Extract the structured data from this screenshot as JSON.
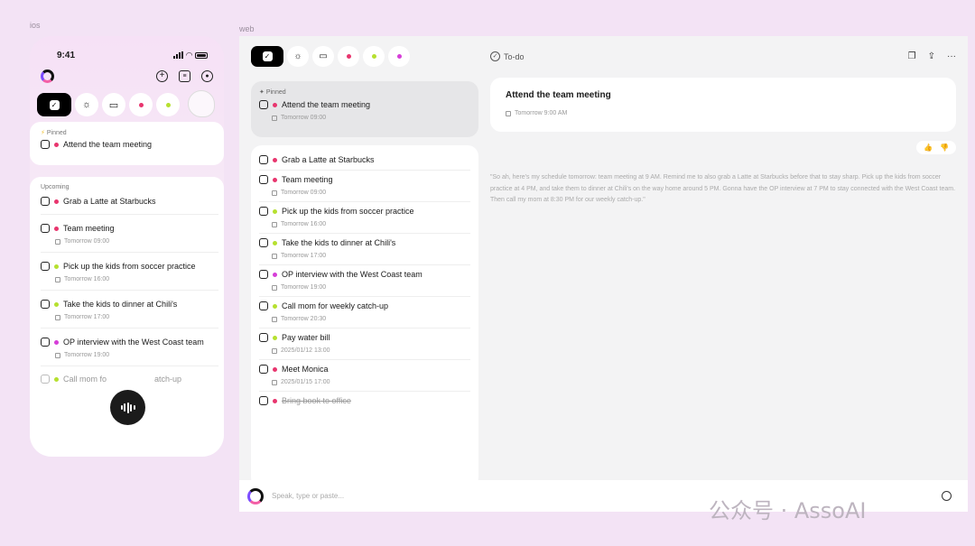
{
  "labels": {
    "ios": "ios",
    "web": "web"
  },
  "ios": {
    "time": "9:41",
    "pinned_title": "Pinned",
    "pinned_item": "Attend the team meeting",
    "upcoming_title": "Upcoming",
    "items": [
      {
        "title": "Grab a Latte at Starbucks",
        "meta": "",
        "dot": "#e8356e"
      },
      {
        "title": "Team meeting",
        "meta": "Tomorrow 09:00",
        "dot": "#e8356e"
      },
      {
        "title": "Pick up the kids from soccer practice",
        "meta": "Tomorrow 16:00",
        "dot": "#b6e02f"
      },
      {
        "title": "Take the kids to dinner at Chili's",
        "meta": "Tomorrow 17:00",
        "dot": "#b6e02f"
      },
      {
        "title": "OP interview with the West Coast team",
        "meta": "Tomorrow 19:00",
        "dot": "#d63ed8"
      }
    ],
    "last_left": "Call mom fo",
    "last_right": "atch-up"
  },
  "web": {
    "pinned_title": "Pinned",
    "pinned_item": "Attend the team meeting",
    "pinned_meta": "Tomorrow 09:00",
    "items": [
      {
        "title": "Grab a Latte  at Starbucks",
        "meta": "",
        "dot": "#e8356e"
      },
      {
        "title": "Team meeting",
        "meta": "Tomorrow 09:00",
        "dot": "#e8356e"
      },
      {
        "title": "Pick up the kids from soccer practice",
        "meta": "Tomorrow 16:00",
        "dot": "#b6e02f"
      },
      {
        "title": "Take the kids to dinner at Chili's",
        "meta": "Tomorrow 17:00",
        "dot": "#b6e02f"
      },
      {
        "title": "OP interview with the West Coast team",
        "meta": "Tomorrow 19:00",
        "dot": "#d63ed8"
      },
      {
        "title": " Call mom for weekly catch-up",
        "meta": "Tomorrow 20:30",
        "dot": "#b6e02f"
      },
      {
        "title": "Pay water bill",
        "meta": "2025/01/12 13:00",
        "dot": "#b6e02f"
      },
      {
        "title": "Meet Monica",
        "meta": "2025/01/15 17:00",
        "dot": "#e8356e"
      }
    ],
    "done_item": "Bring book to office",
    "header_label": "To-do",
    "detail_title": "Attend the team meeting",
    "detail_meta": "Tomorrow 9:00 AM",
    "transcript": "\"So ah, here's my schedule tomorrow: team meeting at 9 AM. Remind me to also grab a Latte at Starbucks before that to stay sharp. Pick up the kids from soccer practice at 4 PM, and take them to dinner at Chili's on the way home around 5 PM. Gonna have the OP interview at 7 PM to stay connected with the West Coast team. Then call my mom at 8:30 PM for our weekly catch-up.\"",
    "input_placeholder": "Speak, type or paste..."
  },
  "watermark": "公众号 · AssoAI",
  "colors": {
    "pink": "#e8356e",
    "lime": "#b6e02f",
    "magenta": "#d63ed8"
  }
}
